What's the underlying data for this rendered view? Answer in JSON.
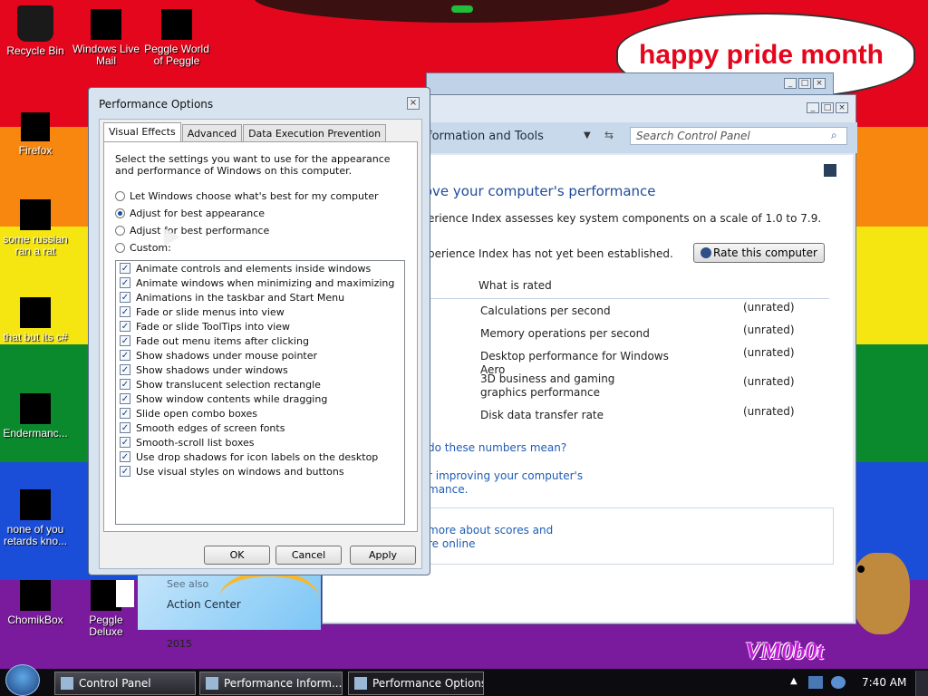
{
  "desktop": {
    "speech_bubble": "happy pride month",
    "watermark": "VM0b0t",
    "icons": [
      {
        "label": "Recycle Bin"
      },
      {
        "label": "Windows Live Mail"
      },
      {
        "label": "Peggle World of Peggle"
      },
      {
        "label": "Firefox"
      },
      {
        "label": "some russian ran a rat"
      },
      {
        "label": "that but its c#"
      },
      {
        "label": "Endermanc..."
      },
      {
        "label": "none of you retards kno..."
      },
      {
        "label": "ChomikBox"
      },
      {
        "label": "Peggle Deluxe"
      }
    ]
  },
  "control_panel": {
    "breadcrumb": "formation and Tools",
    "search_placeholder": "Search Control Panel",
    "heading": "rove your computer's performance",
    "desc1": "erience Index assesses key system components on a scale of 1.0 to 7.9.",
    "desc2": "perience Index has not yet been established.",
    "rate_button": "Rate this computer",
    "column_header": "What is rated",
    "rows": [
      {
        "name": "Calculations per second",
        "value": "(unrated)"
      },
      {
        "name": "Memory operations per second",
        "value": "(unrated)"
      },
      {
        "name": "Desktop performance for Windows Aero",
        "value": "(unrated)"
      },
      {
        "name": "3D business and gaming graphics performance",
        "value": "(unrated)"
      },
      {
        "name": "Disk data transfer rate",
        "value": "(unrated)"
      }
    ],
    "colon_label": ":",
    "link1": "do these numbers mean?",
    "link2a": "r improving your computer's",
    "link2b": "mance.",
    "link3a": "more about scores and",
    "link3b": "re online",
    "see_also": "See also",
    "action_center": "Action Center",
    "year_fragment": "2015"
  },
  "performance_options": {
    "title": "Performance Options",
    "tabs": [
      "Visual Effects",
      "Advanced",
      "Data Execution Prevention"
    ],
    "intro": "Select the settings you want to use for the appearance and performance of Windows on this computer.",
    "radios": [
      {
        "label": "Let Windows choose what's best for my computer",
        "selected": false
      },
      {
        "label": "Adjust for best appearance",
        "selected": true
      },
      {
        "label": "Adjust for best performance",
        "selected": false
      },
      {
        "label": "Custom:",
        "selected": false
      }
    ],
    "effects": [
      "Animate controls and elements inside windows",
      "Animate windows when minimizing and maximizing",
      "Animations in the taskbar and Start Menu",
      "Fade or slide menus into view",
      "Fade or slide ToolTips into view",
      "Fade out menu items after clicking",
      "Show shadows under mouse pointer",
      "Show shadows under windows",
      "Show translucent selection rectangle",
      "Show window contents while dragging",
      "Slide open combo boxes",
      "Smooth edges of screen fonts",
      "Smooth-scroll list boxes",
      "Use drop shadows for icon labels on the desktop",
      "Use visual styles on windows and buttons"
    ],
    "ok": "OK",
    "cancel": "Cancel",
    "apply": "Apply"
  },
  "taskbar": {
    "tasks": [
      "Control Panel",
      "Performance Inform...",
      "Performance Options"
    ],
    "clock": "7:40 AM"
  }
}
